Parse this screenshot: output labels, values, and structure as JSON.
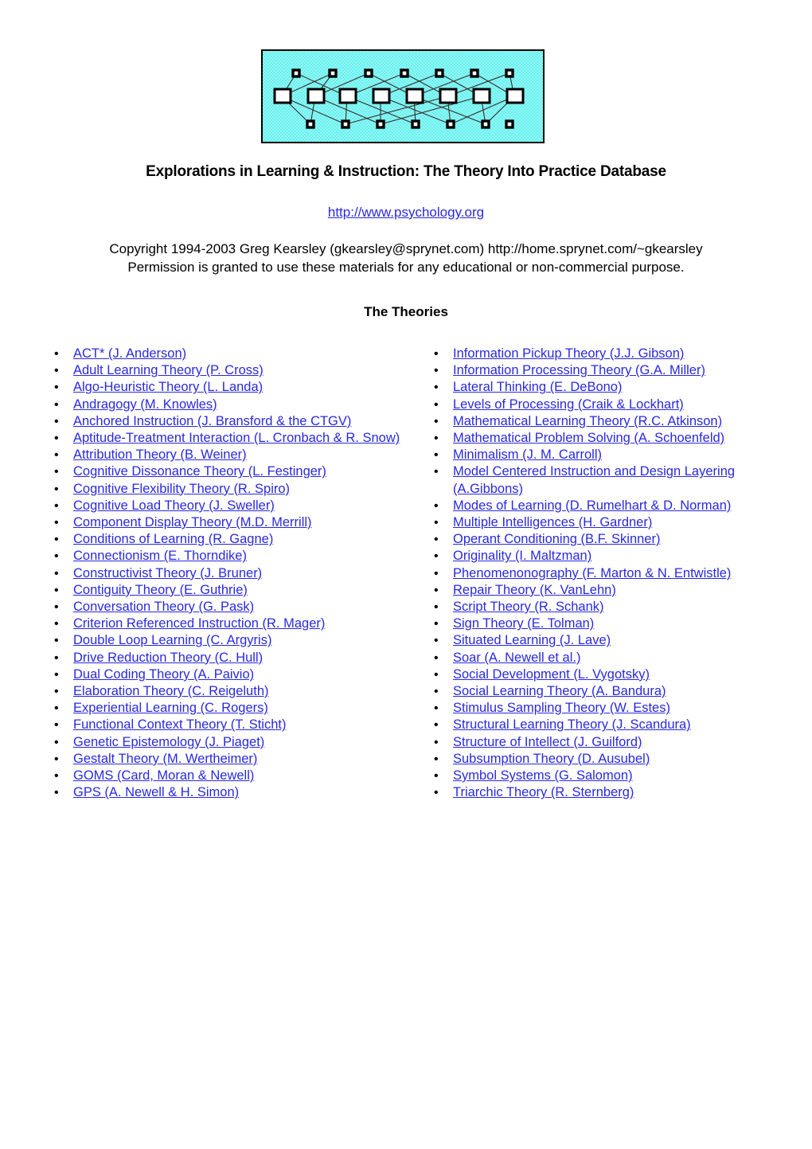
{
  "header_image": {
    "alt": "neural-network-diagram",
    "background_color": "#66f2ef",
    "border_color": "#000000",
    "node_color": "#ffffff",
    "node_border_color": "#000000",
    "top_nodes": 7,
    "middle_nodes": 8,
    "bottom_nodes": 7
  },
  "document": {
    "title": "Explorations in Learning & Instruction: The Theory Into Practice Database",
    "url": "http://www.psychology.org",
    "copyright_line1": "Copyright 1994-2003 Greg Kearsley (gkearsley@sprynet.com) http://home.sprynet.com/~gkearsley",
    "copyright_line2": "Permission is granted to use these materials for any educational or non-commercial purpose.",
    "section_heading": "The Theories",
    "link_color": "#2929e0",
    "bullet_glyph": "•"
  },
  "theories": {
    "left_column": [
      "ACT* (J. Anderson)",
      "Adult Learning Theory (P. Cross)",
      "Algo-Heuristic Theory (L. Landa)",
      "Andragogy (M. Knowles)",
      "Anchored Instruction (J. Bransford & the CTGV)",
      "Aptitude-Treatment Interaction (L. Cronbach & R. Snow)",
      "Attribution Theory (B. Weiner)",
      "Cognitive Dissonance Theory (L. Festinger)",
      "Cognitive Flexibility Theory (R. Spiro)",
      "Cognitive Load Theory (J. Sweller)",
      "Component Display Theory (M.D. Merrill)",
      "Conditions of Learning (R. Gagne)",
      "Connectionism (E. Thorndike)",
      "Constructivist Theory (J. Bruner)",
      "Contiguity Theory (E. Guthrie)",
      "Conversation Theory (G. Pask)",
      "Criterion Referenced Instruction (R. Mager)",
      "Double Loop Learning (C. Argyris)",
      "Drive Reduction Theory (C. Hull)",
      "Dual Coding Theory (A. Paivio)",
      "Elaboration Theory (C. Reigeluth)",
      "Experiential Learning (C. Rogers)",
      "Functional Context Theory (T. Sticht)",
      "Genetic Epistemology (J. Piaget)",
      "Gestalt Theory (M. Wertheimer)",
      "GOMS (Card, Moran & Newell)",
      "GPS (A. Newell & H. Simon)"
    ],
    "right_column": [
      "Information Pickup Theory (J.J. Gibson)",
      "Information Processing Theory (G.A. Miller)",
      "Lateral Thinking (E. DeBono)",
      "Levels of Processing (Craik & Lockhart)",
      "Mathematical Learning Theory (R.C. Atkinson)",
      "Mathematical Problem Solving (A. Schoenfeld)",
      "Minimalism (J. M. Carroll)",
      "Model Centered Instruction and Design Layering (A.Gibbons)",
      "Modes of Learning (D. Rumelhart & D. Norman)",
      "Multiple Intelligences (H. Gardner)",
      "Operant Conditioning (B.F. Skinner)",
      "Originality (I. Maltzman)",
      "Phenomenonography (F. Marton & N. Entwistle)",
      "Repair Theory (K. VanLehn)",
      "Script Theory (R. Schank)",
      "Sign Theory (E. Tolman)",
      "Situated Learning (J. Lave)",
      "Soar (A. Newell et al.)",
      "Social Development (L. Vygotsky)",
      "Social Learning Theory (A. Bandura)",
      "Stimulus Sampling Theory (W. Estes)",
      "Structural Learning Theory (J. Scandura)",
      "Structure of Intellect (J. Guilford)",
      "Subsumption Theory (D. Ausubel)",
      "Symbol Systems (G. Salomon)",
      "Triarchic Theory (R. Sternberg)"
    ]
  }
}
